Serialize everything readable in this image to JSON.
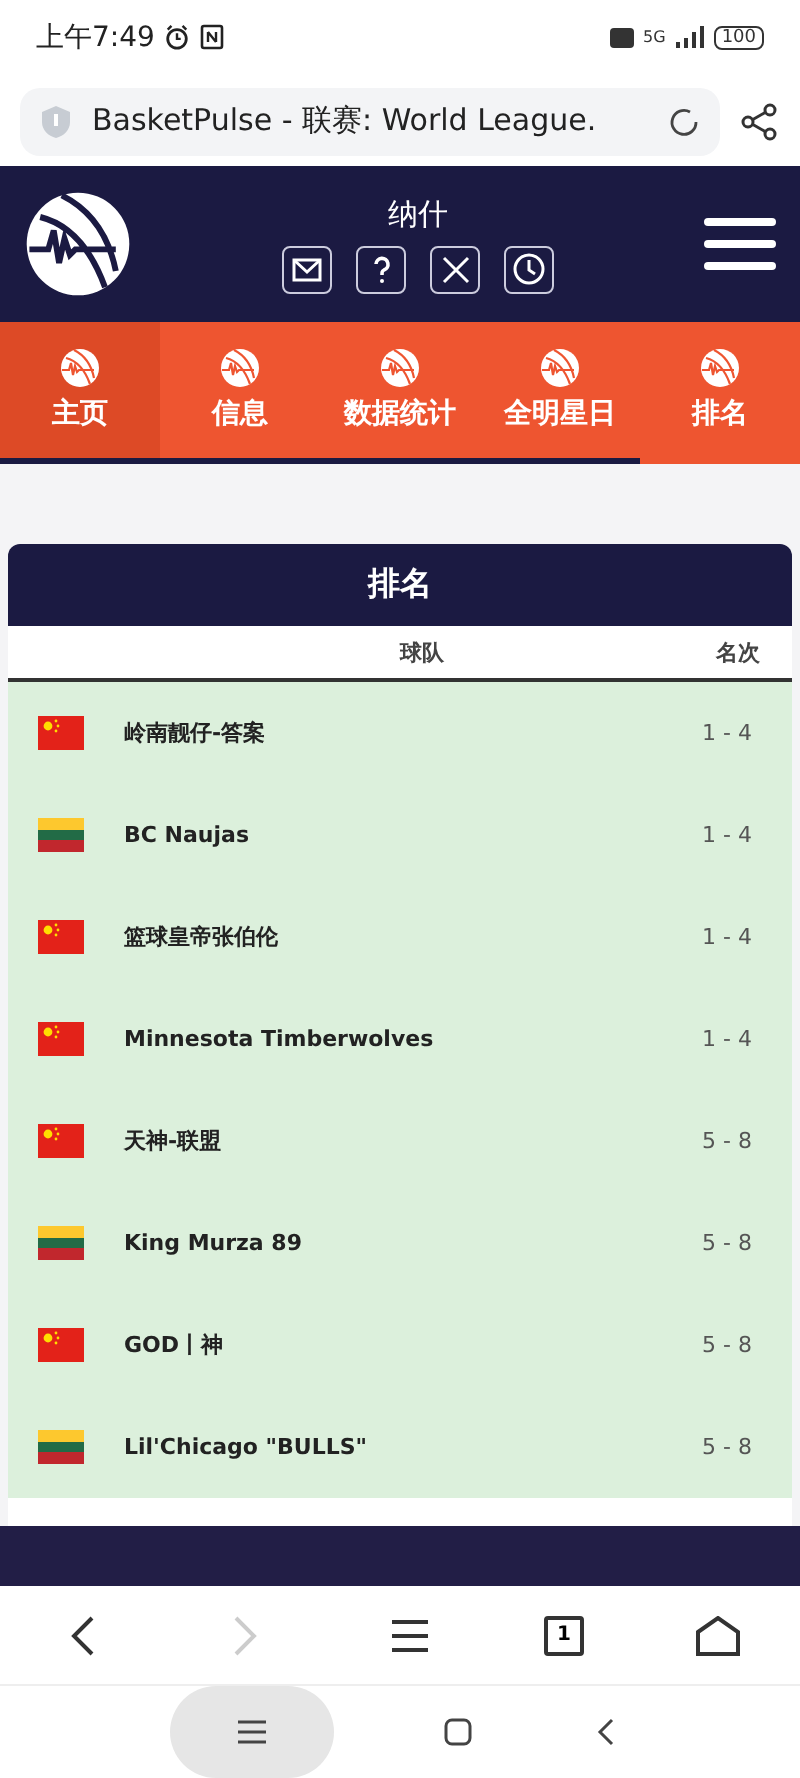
{
  "status_bar": {
    "time": "上午7:49",
    "battery": "100",
    "network": "5G"
  },
  "address_bar": {
    "title": "BasketPulse - 联赛: World League."
  },
  "header": {
    "title": "纳什"
  },
  "tabs": [
    {
      "label": "主页",
      "selected": true
    },
    {
      "label": "信息",
      "selected": false
    },
    {
      "label": "数据统计",
      "selected": false
    },
    {
      "label": "全明星日",
      "selected": false
    },
    {
      "label": "排名",
      "selected": false
    }
  ],
  "standings": {
    "title": "排名",
    "columns": [
      "球队",
      "名次"
    ],
    "rows": [
      {
        "kind": "china",
        "team": "岭南靓仔-答案",
        "rank": "1 - 4"
      },
      {
        "kind": "lithuania",
        "team": "BC Naujas",
        "rank": "1 - 4"
      },
      {
        "kind": "china",
        "team": "篮球皇帝张伯伦",
        "rank": "1 - 4"
      },
      {
        "kind": "china",
        "team": "Minnesota Timberwolves",
        "rank": "1 - 4"
      },
      {
        "kind": "china",
        "team": "天神-联盟",
        "rank": "5 - 8"
      },
      {
        "kind": "lithuania",
        "team": "King Murza 89",
        "rank": "5 - 8"
      },
      {
        "kind": "china",
        "team": "GOD丨神",
        "rank": "5 - 8"
      },
      {
        "kind": "lithuania",
        "team": "Lil'Chicago \"BULLS\"",
        "rank": "5 - 8"
      }
    ]
  },
  "browser_toolbar": {
    "forward_disabled": true,
    "tab_count": "1"
  }
}
